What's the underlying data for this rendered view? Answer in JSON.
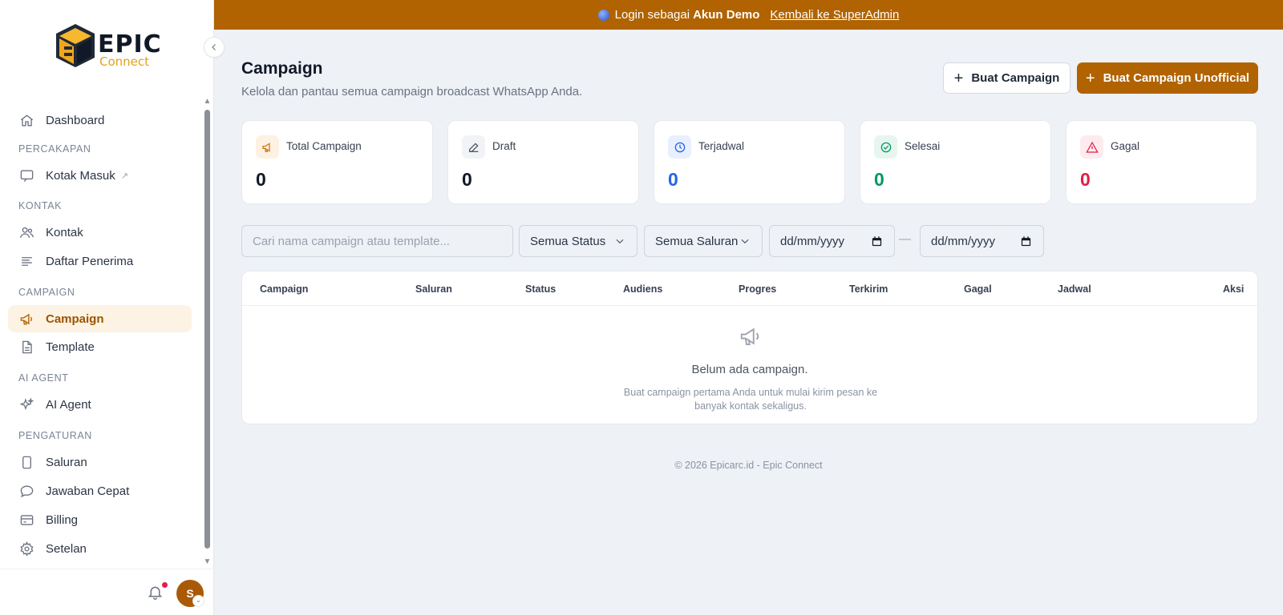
{
  "brand": {
    "name": "EPIC",
    "sub": "Connect"
  },
  "banner": {
    "prefix": "Login sebagai",
    "account": "Akun Demo",
    "link": "Kembali ke SuperAdmin"
  },
  "sidebar": {
    "dashboard": "Dashboard",
    "sections": [
      "PERCAKAPAN",
      "KONTAK",
      "CAMPAIGN",
      "AI AGENT",
      "PENGATURAN"
    ],
    "items": {
      "kotak_masuk": "Kotak Masuk",
      "kontak": "Kontak",
      "daftar_penerima": "Daftar Penerima",
      "campaign": "Campaign",
      "template": "Template",
      "ai_agent": "AI Agent",
      "saluran": "Saluran",
      "jawaban_cepat": "Jawaban Cepat",
      "billing": "Billing",
      "setelan": "Setelan"
    },
    "avatar": "S"
  },
  "header": {
    "title": "Campaign",
    "subtitle": "Kelola dan pantau semua campaign broadcast WhatsApp Anda.",
    "btn_create": "Buat Campaign",
    "btn_create_unofficial": "Buat Campaign Unofficial"
  },
  "stats": [
    {
      "label": "Total Campaign",
      "value": "0",
      "color": "#111827"
    },
    {
      "label": "Draft",
      "value": "0",
      "color": "#111827"
    },
    {
      "label": "Terjadwal",
      "value": "0",
      "color": "#2563eb"
    },
    {
      "label": "Selesai",
      "value": "0",
      "color": "#059669"
    },
    {
      "label": "Gagal",
      "value": "0",
      "color": "#e11d48"
    }
  ],
  "filters": {
    "search_placeholder": "Cari nama campaign atau template...",
    "status": "Semua Status",
    "channel": "Semua Saluran",
    "date_from": "dd/mm/yyyy",
    "date_to": "dd/mm/yyyy",
    "separator": "—"
  },
  "table": {
    "columns": [
      "Campaign",
      "Saluran",
      "Status",
      "Audiens",
      "Progres",
      "Terkirim",
      "Gagal",
      "Jadwal",
      "Aksi"
    ],
    "empty_title": "Belum ada campaign.",
    "empty_desc": "Buat campaign pertama Anda untuk mulai kirim pesan ke banyak kontak sekaligus."
  },
  "footer": "© 2026 Epicarc.id - Epic Connect",
  "colors": {
    "accent": "#b06300",
    "active_bg": "#fdf3e4"
  }
}
